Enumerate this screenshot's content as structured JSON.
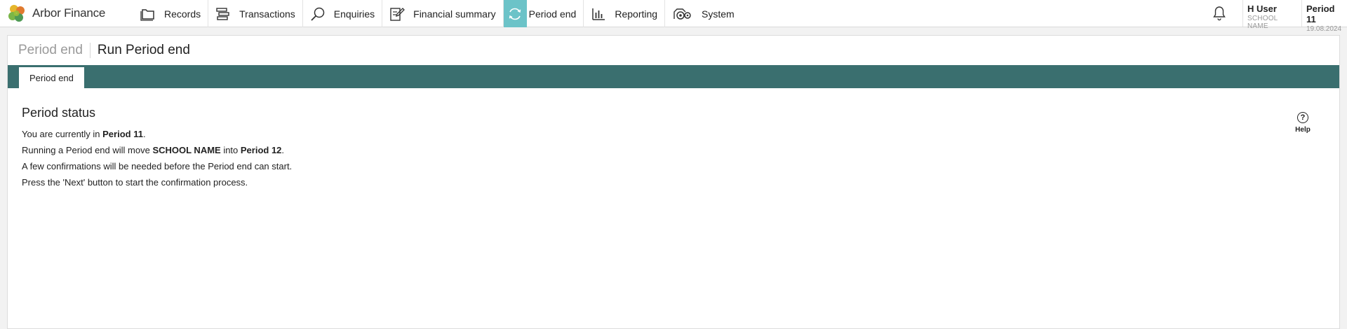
{
  "app": {
    "name": "Arbor Finance"
  },
  "nav": {
    "items": [
      {
        "key": "records",
        "label": "Records",
        "icon": "folder-icon"
      },
      {
        "key": "transactions",
        "label": "Transactions",
        "icon": "stack-icon"
      },
      {
        "key": "enquiries",
        "label": "Enquiries",
        "icon": "search-icon"
      },
      {
        "key": "financial_summary",
        "label": "Financial summary",
        "icon": "clipboard-edit-icon"
      },
      {
        "key": "period_end",
        "label": "Period end",
        "icon": "refresh-icon",
        "active": true
      },
      {
        "key": "reporting",
        "label": "Reporting",
        "icon": "bar-chart-icon"
      },
      {
        "key": "system",
        "label": "System",
        "icon": "cogs-icon"
      }
    ]
  },
  "user": {
    "name": "H User",
    "school": "SCHOOL NAME"
  },
  "period": {
    "name": "Period 11",
    "date": "19.08.2024"
  },
  "page": {
    "breadcrumb": "Period end",
    "title": "Run Period end"
  },
  "tabs": [
    {
      "label": "Period end",
      "active": true
    }
  ],
  "status": {
    "title": "Period status",
    "line1_pre": "You are currently in ",
    "line1_period": "Period 11",
    "line1_post": ".",
    "line2_pre": "Running a Period end will move ",
    "line2_school": "SCHOOL NAME",
    "line2_mid": " into ",
    "line2_period": "Period 12",
    "line2_post": ".",
    "line3": "A few confirmations will be needed before the Period end can start.",
    "line4": "Press the 'Next' button to start the confirmation process."
  },
  "help": {
    "label": "Help",
    "glyph": "?"
  },
  "colors": {
    "teal_bar": "#3a6f6f",
    "active_nav": "#6cc3c8"
  }
}
